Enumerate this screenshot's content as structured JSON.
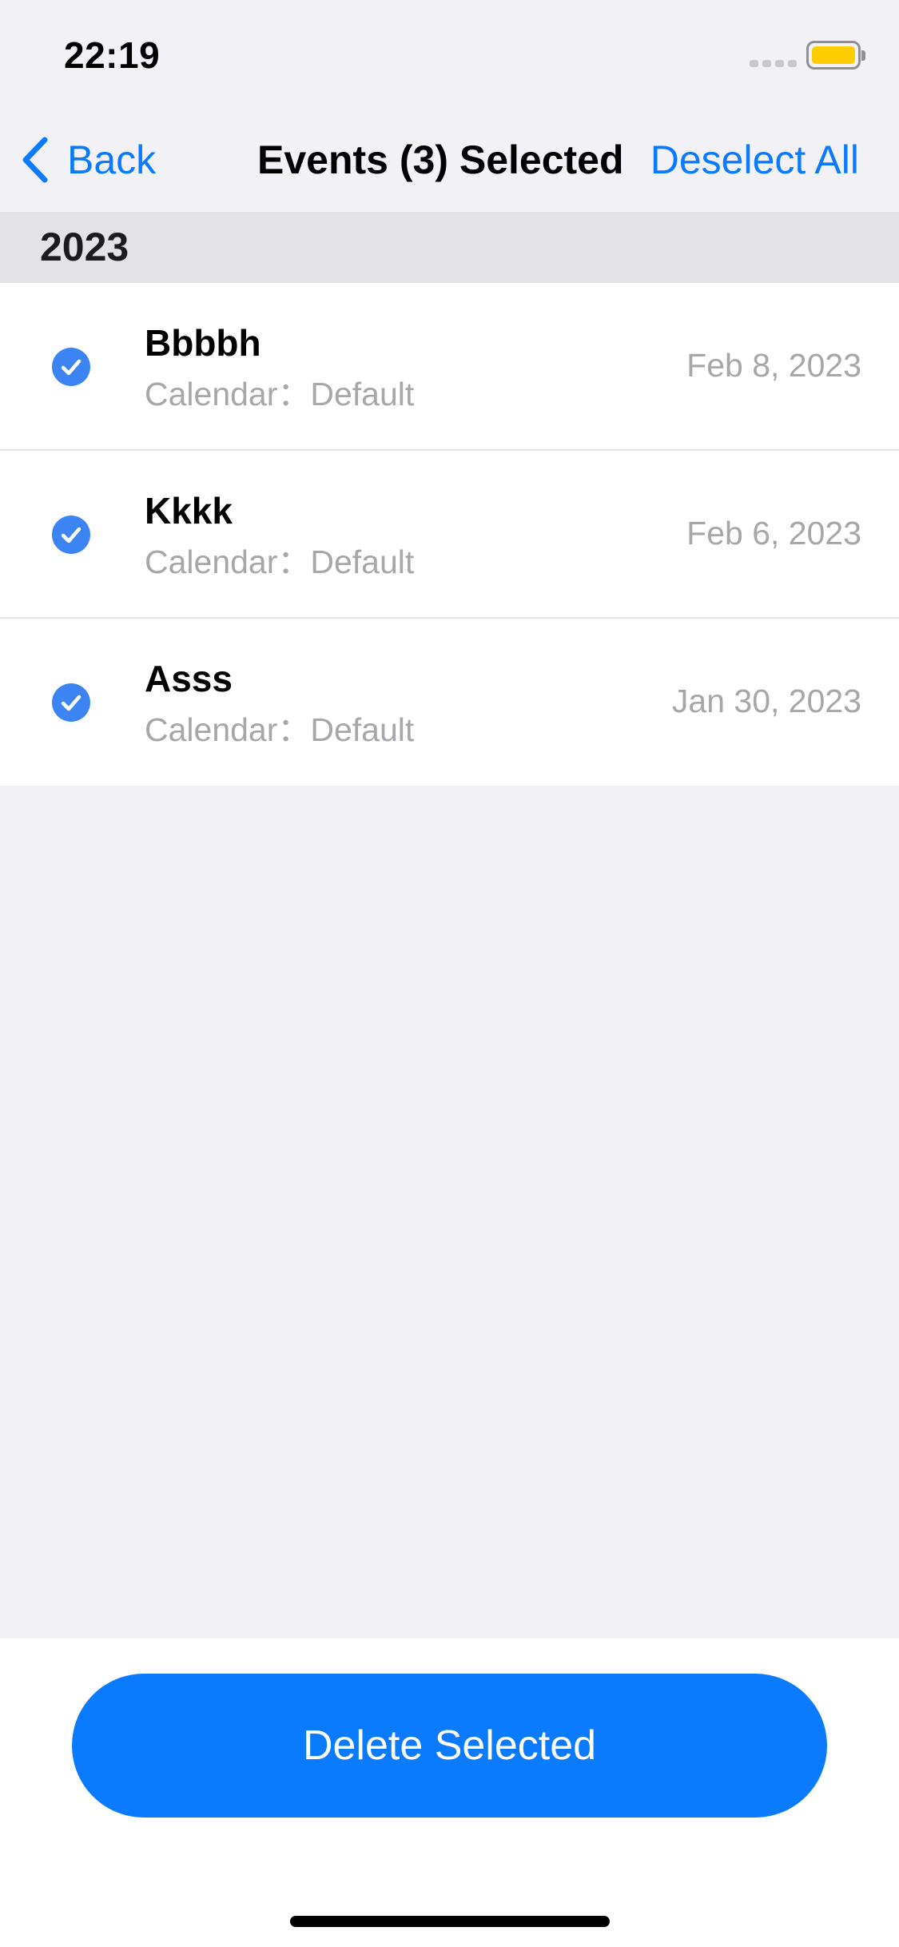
{
  "status_bar": {
    "time": "22:19",
    "battery_color": "#ffcc00"
  },
  "nav": {
    "back_label": "Back",
    "title": "Events (3) Selected",
    "right_action": "Deselect All",
    "accent_color": "#0a7aff"
  },
  "section": {
    "year": "2023"
  },
  "events": [
    {
      "title": "Bbbbh",
      "subtitle": "Calendar：Default",
      "date": "Feb 8, 2023",
      "selected": true
    },
    {
      "title": "Kkkk",
      "subtitle": "Calendar：Default",
      "date": "Feb 6, 2023",
      "selected": true
    },
    {
      "title": "Asss",
      "subtitle": "Calendar：Default",
      "date": "Jan 30, 2023",
      "selected": true
    }
  ],
  "footer": {
    "delete_label": "Delete Selected"
  },
  "icons": {
    "back": "chevron-left-icon",
    "check": "checkmark-circle-icon"
  }
}
